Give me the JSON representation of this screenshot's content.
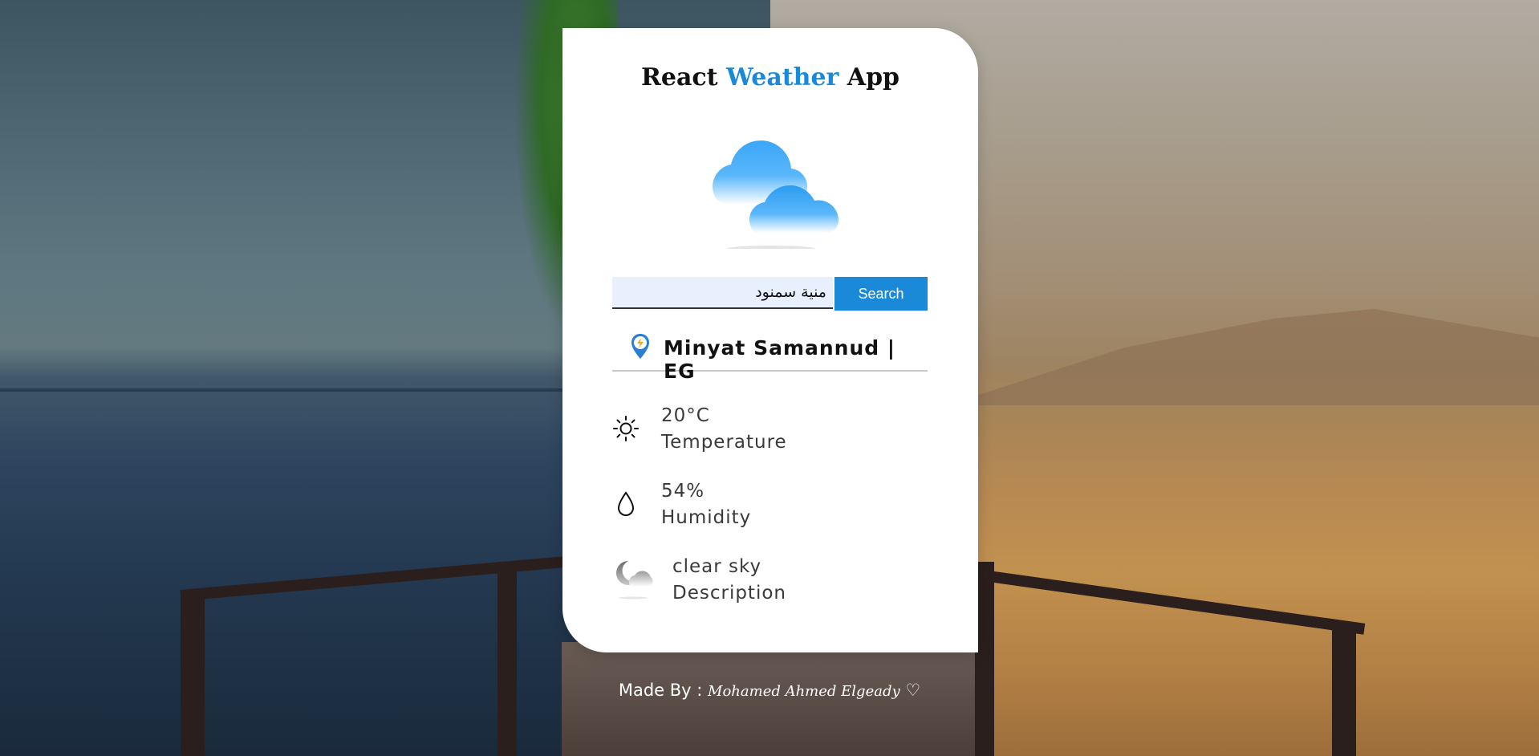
{
  "app": {
    "title_part1": "React",
    "title_accent": "Weather",
    "title_part2": "App"
  },
  "search": {
    "value": "منية سمنود",
    "button_label": "Search"
  },
  "location": {
    "name": "Minyat Samannud | EG"
  },
  "stats": [
    {
      "value": "20°C",
      "label": "Temperature",
      "icon": "sun-icon"
    },
    {
      "value": "54%",
      "label": "Humidity",
      "icon": "droplet-icon"
    },
    {
      "value": "clear sky",
      "label": "Description",
      "icon": "moon-cloud-icon"
    }
  ],
  "footer": {
    "prefix": "Made By :",
    "author": "Mohamed Ahmed Elgeady",
    "heart": "♡"
  },
  "colors": {
    "accent": "#1a8ad8",
    "card": "#ffffff",
    "input_bg": "#e8f0fe"
  }
}
